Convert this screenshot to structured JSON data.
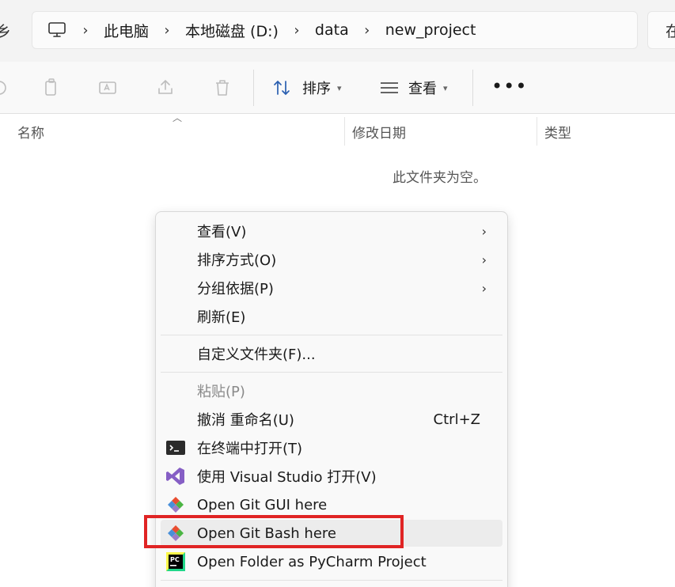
{
  "address": {
    "edge_glyph": "乡",
    "breadcrumbs": [
      "此电脑",
      "本地磁盘 (D:)",
      "data",
      "new_project"
    ],
    "search_stub": "在"
  },
  "toolbar": {
    "sort_label": "排序",
    "view_label": "查看",
    "more_label": "•••"
  },
  "columns": {
    "name": "名称",
    "modified": "修改日期",
    "type": "类型"
  },
  "empty_message": "此文件夹为空。",
  "context_menu": {
    "view": "查看(V)",
    "sort_by": "排序方式(O)",
    "group_by": "分组依据(P)",
    "refresh": "刷新(E)",
    "customize_folder": "自定义文件夹(F)...",
    "paste": "粘贴(P)",
    "undo_rename": "撤消 重命名(U)",
    "undo_shortcut": "Ctrl+Z",
    "open_terminal": "在终端中打开(T)",
    "open_visual_studio": "使用 Visual Studio 打开(V)",
    "open_git_gui": "Open Git GUI here",
    "open_git_bash": "Open Git Bash here",
    "open_pycharm": "Open Folder as PyCharm Project",
    "pycharm_icon_text": "PC"
  },
  "colors": {
    "highlight_border": "#e02424",
    "vs_purple": "#865fc5",
    "git_red": "#e94e31",
    "git_green": "#4bb543",
    "git_blue": "#4a90d9"
  },
  "icons": {
    "breadcrumb_root": "monitor-icon",
    "separator": "chevron-right-icon",
    "terminal": "terminal-icon",
    "visual_studio": "visual-studio-icon",
    "git": "git-diamond-icon",
    "pycharm": "pycharm-icon"
  }
}
